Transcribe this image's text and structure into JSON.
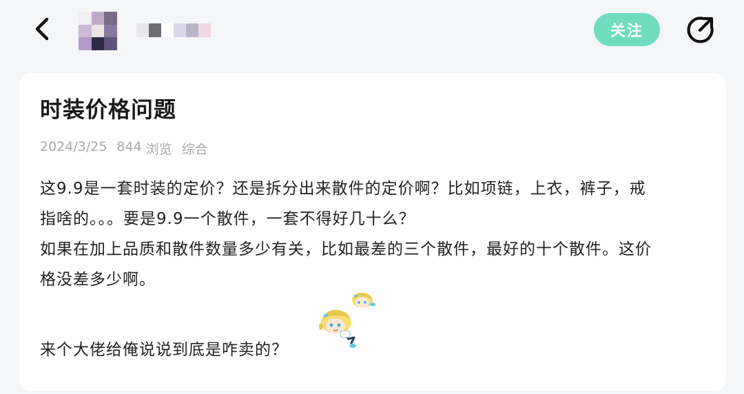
{
  "header": {
    "follow_label": "关注"
  },
  "post": {
    "title": "时装价格问题",
    "date": "2024/3/25",
    "views_count": "844",
    "views_label": "浏览",
    "category": "综合",
    "lines": [
      "这9.9是一套时装的定价？还是拆分出来散件的定价啊？比如项链，上衣，裤子，戒",
      "指啥的。。。要是9.9一个散件，一套不得好几十么？",
      "如果在加上品质和散件数量多少有关，比如最差的三个散件，最好的十个散件。这价",
      "格没差多少啊。"
    ],
    "closing": "来个大佬给俺说说到底是咋卖的？"
  },
  "icons": {
    "back": "chevron-left-icon",
    "share": "share-arrow-icon",
    "sticker": "anime-character-sticker"
  },
  "colors": {
    "accent": "#6fdcc0",
    "background": "#f5f6f8",
    "card": "#ffffff",
    "meta_text": "#a8a8a8"
  }
}
